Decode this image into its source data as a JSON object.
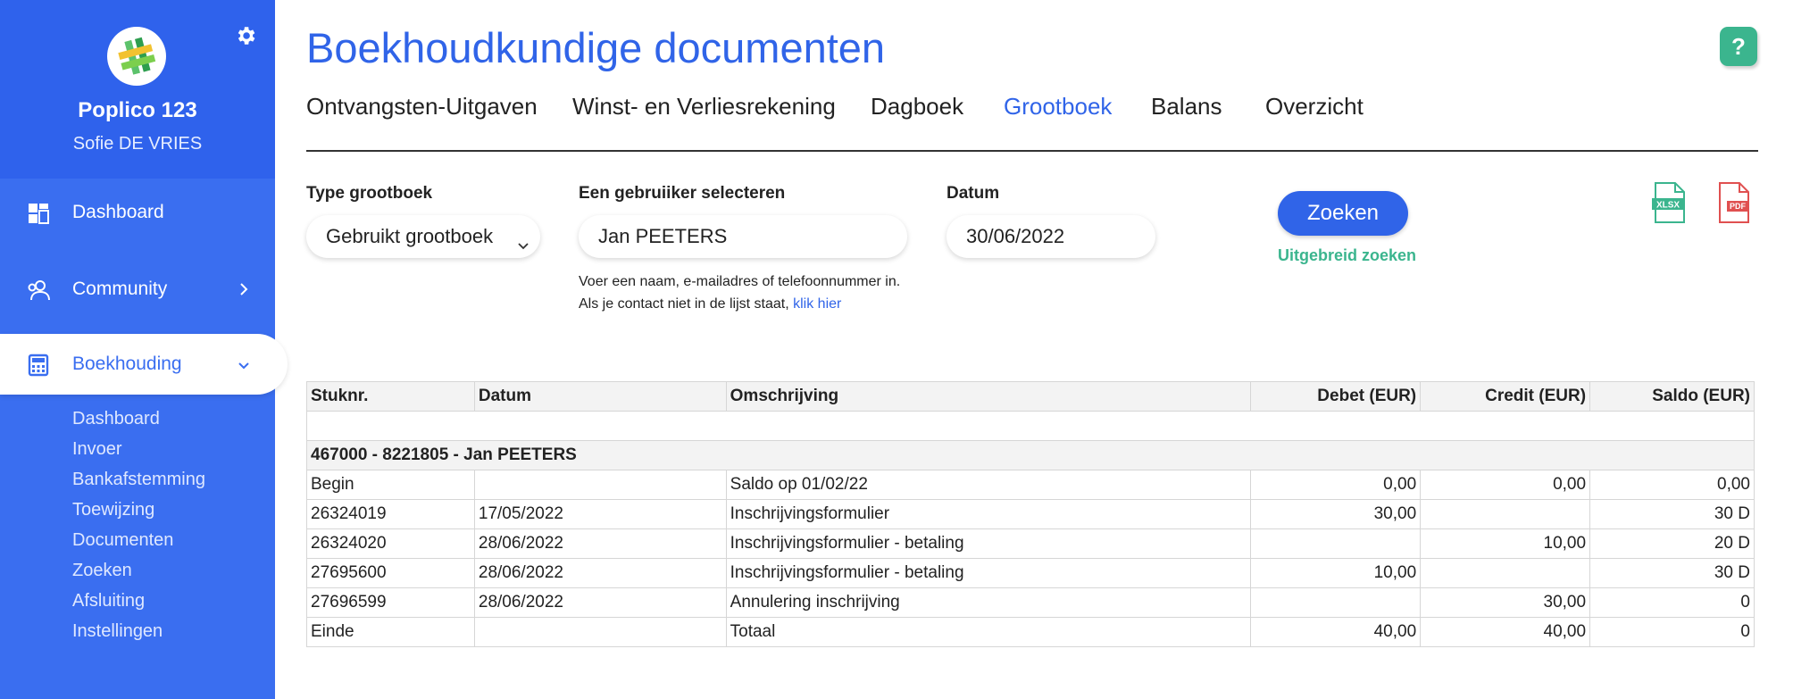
{
  "app": {
    "name": "Poplico 123",
    "user": "Sofie DE VRIES"
  },
  "sidebar": {
    "items": [
      {
        "label": "Dashboard",
        "icon": "dashboard-icon"
      },
      {
        "label": "Community",
        "icon": "community-icon"
      },
      {
        "label": "Boekhouding",
        "icon": "calculator-icon",
        "active": true
      }
    ],
    "subitems": [
      "Dashboard",
      "Invoer",
      "Bankafstemming",
      "Toewijzing",
      "Documenten",
      "Zoeken",
      "Afsluiting",
      "Instellingen"
    ]
  },
  "page": {
    "title": "Boekhoudkundige documenten",
    "help": "?"
  },
  "tabs": [
    "Ontvangsten-Uitgaven",
    "Winst- en Verliesrekening",
    "Dagboek",
    "Grootboek",
    "Balans",
    "Overzicht"
  ],
  "active_tab": "Grootboek",
  "filters": {
    "type_label": "Type grootboek",
    "type_value": "Gebruikt grootboek",
    "user_label": "Een gebruiiker selecteren",
    "user_value": "Jan PEETERS",
    "hint_line1": "Voer een naam, e-mailadres of telefoonnummer in.",
    "hint_line2": "Als je contact niet in de lijst staat,",
    "hint_link": "klik hier",
    "date_label": "Datum",
    "date_value": "30/06/2022",
    "search_button": "Zoeken",
    "advanced_search": "Uitgebreid zoeken"
  },
  "exports": {
    "xlsx": "XLSX",
    "pdf": "PDF"
  },
  "table": {
    "headers": [
      "Stuknr.",
      "Datum",
      "Omschrijving",
      "Debet (EUR)",
      "Credit (EUR)",
      "Saldo (EUR)"
    ],
    "group": "467000 - 8221805 - Jan PEETERS",
    "rows": [
      [
        "Begin",
        "",
        "Saldo op 01/02/22",
        "0,00",
        "0,00",
        "0,00"
      ],
      [
        "26324019",
        "17/05/2022",
        "Inschrijvingsformulier",
        "30,00",
        "",
        "30 D"
      ],
      [
        "26324020",
        "28/06/2022",
        "Inschrijvingsformulier - betaling",
        "",
        "10,00",
        "20 D"
      ],
      [
        "27695600",
        "28/06/2022",
        "Inschrijvingsformulier - betaling",
        "10,00",
        "",
        "30 D"
      ],
      [
        "27696599",
        "28/06/2022",
        "Annulering inschrijving",
        "",
        "30,00",
        "0"
      ],
      [
        "Einde",
        "",
        "Totaal",
        "40,00",
        "40,00",
        "0"
      ]
    ]
  },
  "colors": {
    "sidebar": "#3a6ef0",
    "accent": "#3064e8",
    "green": "#3bb58e"
  }
}
